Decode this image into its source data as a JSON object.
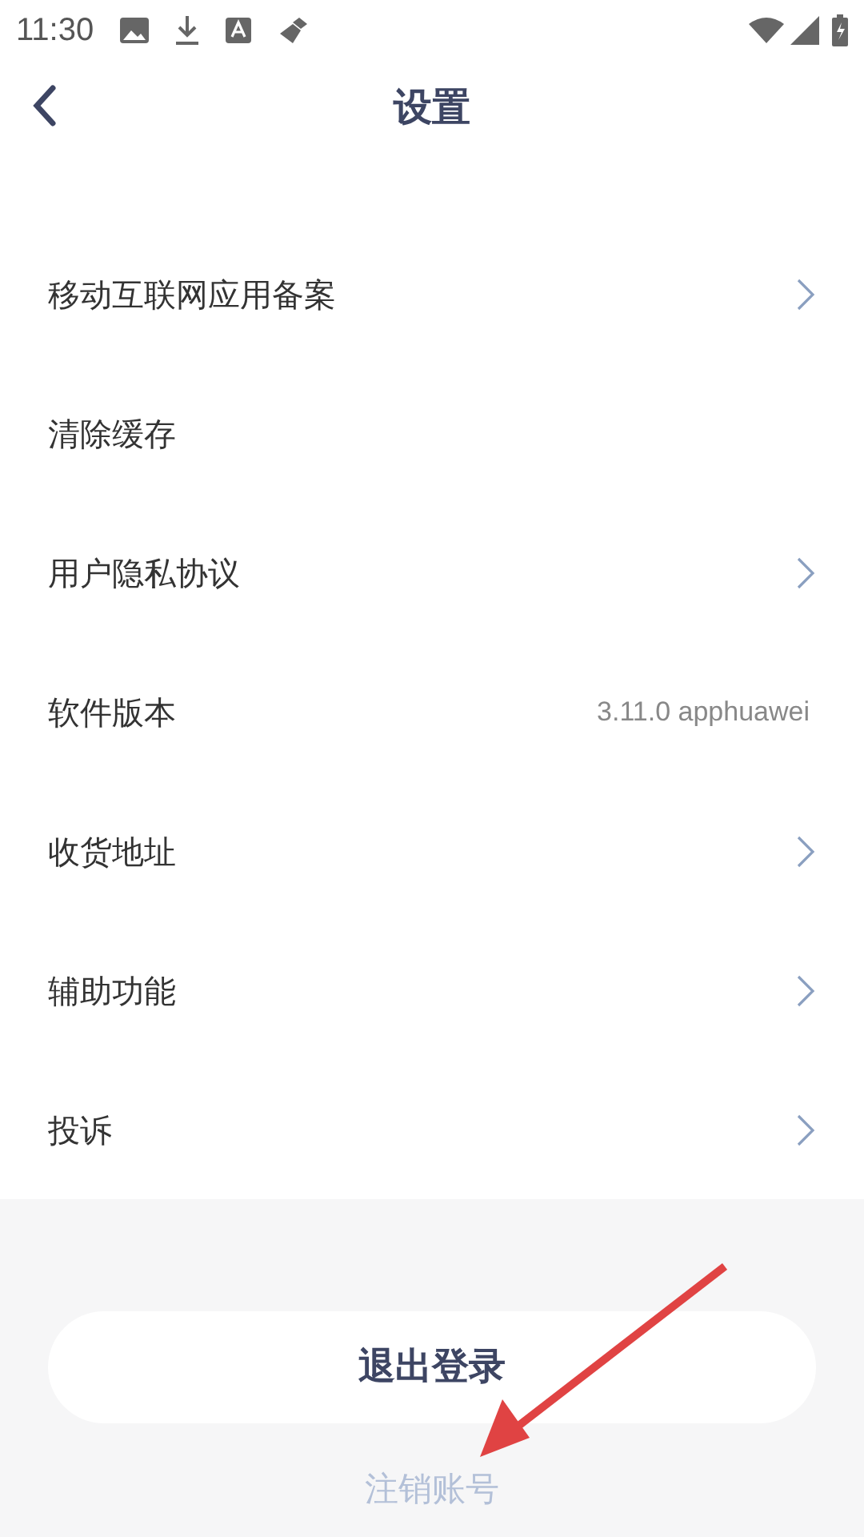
{
  "status_bar": {
    "time": "11:30"
  },
  "header": {
    "title": "设置"
  },
  "settings": [
    {
      "label": "移动互联网应用备案",
      "kind": "link"
    },
    {
      "label": "清除缓存",
      "kind": "plain"
    },
    {
      "label": "用户隐私协议",
      "kind": "link"
    },
    {
      "label": "软件版本",
      "kind": "value",
      "value": "3.11.0 apphuawei"
    },
    {
      "label": "收货地址",
      "kind": "link"
    },
    {
      "label": "辅助功能",
      "kind": "link"
    },
    {
      "label": "投诉",
      "kind": "link"
    }
  ],
  "logout_button": "退出登录",
  "delete_account": "注销账号"
}
